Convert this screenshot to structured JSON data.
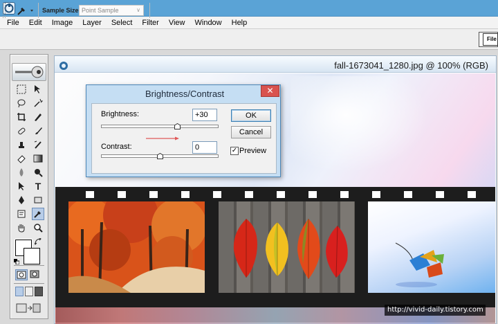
{
  "menu": [
    "File",
    "Edit",
    "Image",
    "Layer",
    "Select",
    "Filter",
    "View",
    "Window",
    "Help"
  ],
  "options_bar": {
    "sample_size_label": "Sample Size:",
    "sample_size_value": "Point Sample",
    "right_button": "File"
  },
  "document": {
    "title": "fall-1673041_1280.jpg @ 100% (RGB)"
  },
  "dialog": {
    "title": "Brightness/Contrast",
    "close_label": "✕",
    "brightness_label": "Brightness:",
    "brightness_value": "+30",
    "brightness_fraction": 0.65,
    "contrast_label": "Contrast:",
    "contrast_value": "0",
    "contrast_fraction": 0.5,
    "ok_label": "OK",
    "cancel_label": "Cancel",
    "preview_label": "Preview",
    "preview_checked": "✓"
  },
  "watermark": "http://vivid-daily.tistory.com",
  "colors": {
    "titlebar": "#5aa3d6",
    "dialog_frame": "#c5def3",
    "close_button": "#d9534f",
    "arrow": "#e05a5a"
  }
}
